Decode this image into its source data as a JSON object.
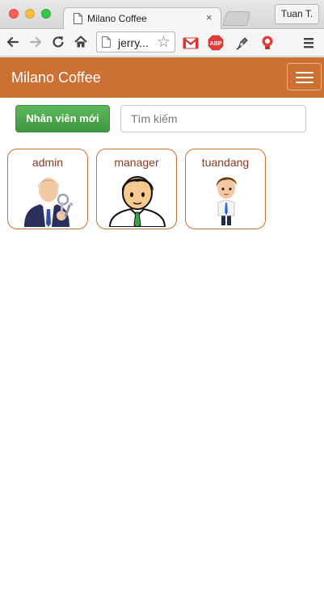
{
  "browser": {
    "tab_title": "Milano Coffee",
    "tab_close": "×",
    "profile_name": "Tuan T.",
    "url": "jerry...",
    "star": "☆",
    "extensions": [
      "gmail-icon",
      "adblock-plus-icon",
      "pen-tool-icon",
      "lightbulb-icon"
    ]
  },
  "navbar": {
    "brand": "Milano Coffee",
    "bg_color": "#cc7033"
  },
  "actions": {
    "new_employee_label": "Nhân viên mới",
    "search_placeholder": "Tìm kiếm"
  },
  "employees": [
    {
      "name": "admin",
      "avatar": "businessman-keys-avatar"
    },
    {
      "name": "manager",
      "avatar": "manager-cartoon-avatar"
    },
    {
      "name": "tuandang",
      "avatar": "cartoon-man-avatar"
    }
  ]
}
